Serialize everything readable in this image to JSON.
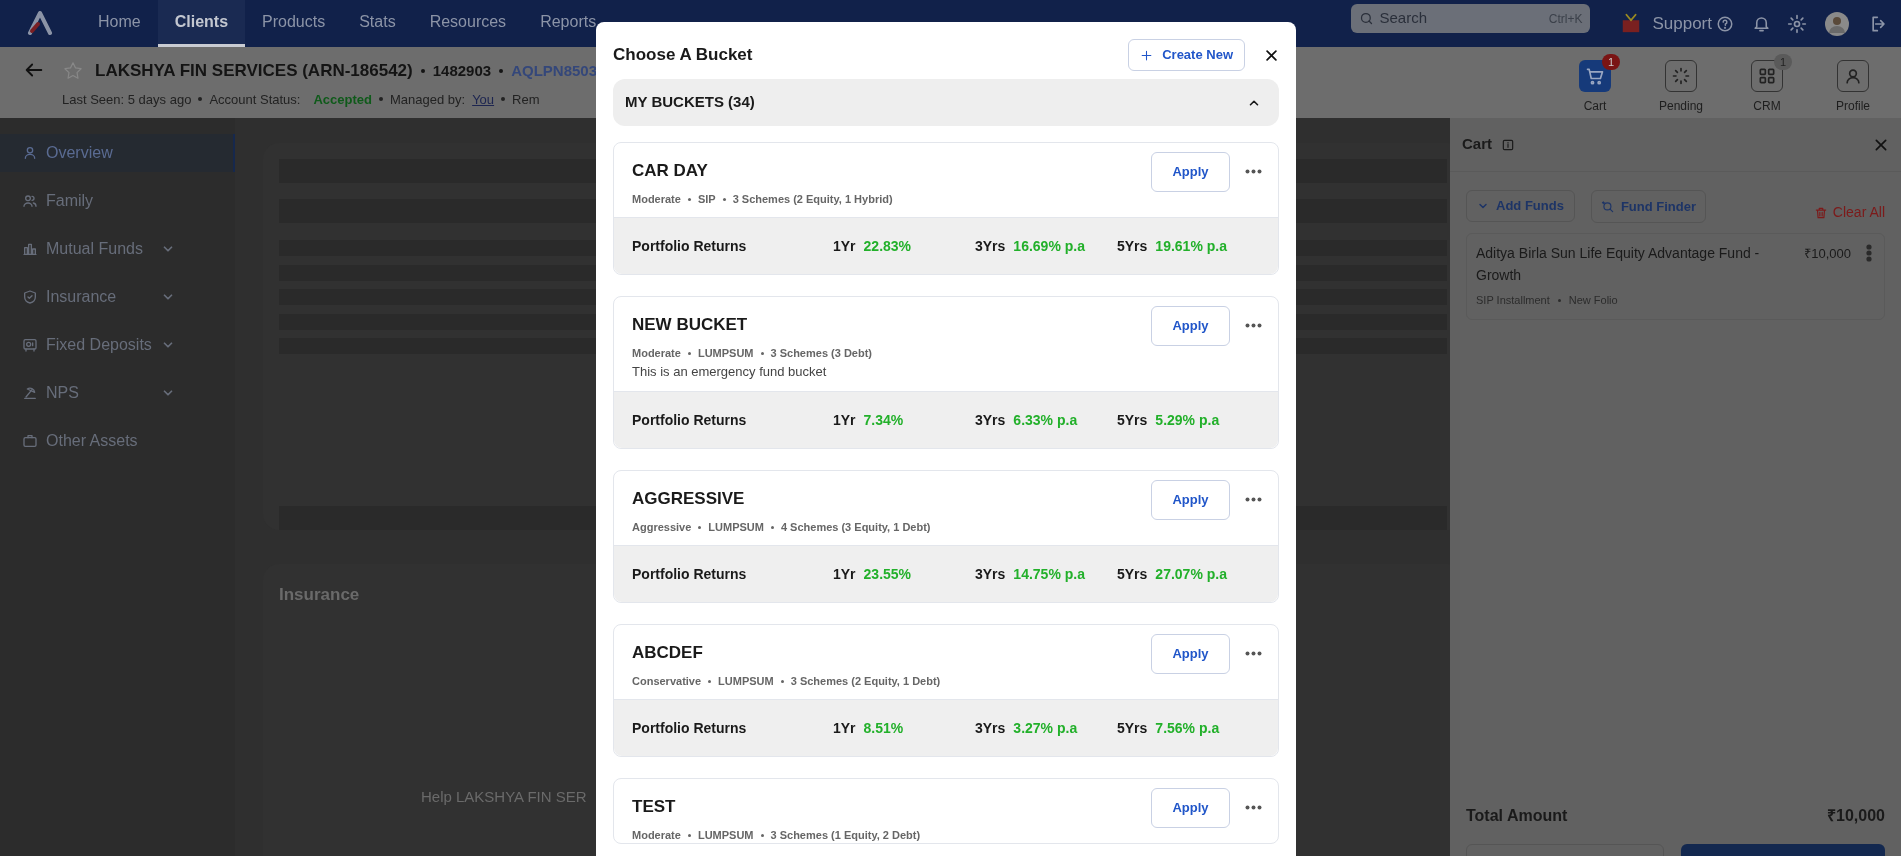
{
  "nav": {
    "items": [
      {
        "label": "Home",
        "selected": false
      },
      {
        "label": "Clients",
        "selected": true
      },
      {
        "label": "Products",
        "selected": false
      },
      {
        "label": "Stats",
        "selected": false
      },
      {
        "label": "Resources",
        "selected": false
      },
      {
        "label": "Reports",
        "selected": false
      }
    ],
    "search": {
      "placeholder": "Search",
      "shortcut": "Ctrl+K"
    },
    "support": "Support"
  },
  "client": {
    "name": "LAKSHYA FIN SERVICES (ARN-186542)",
    "code": "1482903",
    "pan": "AQLPN8503",
    "last_seen": "Last Seen: 5 days ago",
    "status_label": "Account Status:",
    "status": "Accepted",
    "managed_label": "Managed by:",
    "managed_by": "You",
    "more": "Rem"
  },
  "actions": [
    {
      "label": "Cart",
      "badge": "1",
      "selected": true
    },
    {
      "label": "Pending",
      "selected": false
    },
    {
      "label": "CRM",
      "badge": "1",
      "selected": false
    },
    {
      "label": "Profile",
      "selected": false
    }
  ],
  "sidebar": {
    "items": [
      {
        "label": "Overview",
        "selected": true,
        "expandable": false
      },
      {
        "label": "Family",
        "selected": false,
        "expandable": false
      },
      {
        "label": "Mutual Funds",
        "selected": false,
        "expandable": true
      },
      {
        "label": "Insurance",
        "selected": false,
        "expandable": true
      },
      {
        "label": "Fixed Deposits",
        "selected": false,
        "expandable": true
      },
      {
        "label": "NPS",
        "selected": false,
        "expandable": true
      },
      {
        "label": "Other Assets",
        "selected": false,
        "expandable": false
      }
    ]
  },
  "main": {
    "insurance_title": "Insurance",
    "help_text": "Help LAKSHYA FIN SER"
  },
  "cart": {
    "title": "Cart",
    "add_funds": "Add Funds",
    "fund_finder": "Fund Finder",
    "clear": "Clear All",
    "items": [
      {
        "name": "Aditya Birla Sun Life Equity Advantage Fund - Growth",
        "amount": "₹10,000",
        "mode": "SIP Installment",
        "folio": "New Folio"
      }
    ],
    "total_label": "Total Amount",
    "total": "₹10,000"
  },
  "modal": {
    "title": "Choose A Bucket",
    "create": "Create New",
    "section": {
      "title": "MY BUCKETS (34)",
      "expanded": true
    },
    "buckets": [
      {
        "name": "CAR DAY",
        "risk": "Moderate",
        "mode": "SIP",
        "schemes": "3 Schemes (2 Equity, 1 Hybrid)",
        "action": "Apply",
        "returns_label": "Portfolio Returns",
        "returns": [
          {
            "period": "1Yr",
            "value": "22.83%"
          },
          {
            "period": "3Yrs",
            "value": "16.69% p.a"
          },
          {
            "period": "5Yrs",
            "value": "19.61% p.a"
          }
        ]
      },
      {
        "name": "NEW BUCKET",
        "risk": "Moderate",
        "mode": "LUMPSUM",
        "schemes": "3 Schemes (3 Debt)",
        "description": "This is an emergency fund bucket",
        "action": "Apply",
        "returns_label": "Portfolio Returns",
        "returns": [
          {
            "period": "1Yr",
            "value": "7.34%"
          },
          {
            "period": "3Yrs",
            "value": "6.33% p.a"
          },
          {
            "period": "5Yrs",
            "value": "5.29% p.a"
          }
        ]
      },
      {
        "name": "AGGRESSIVE",
        "risk": "Aggressive",
        "mode": "LUMPSUM",
        "schemes": "4 Schemes (3 Equity, 1 Debt)",
        "action": "Apply",
        "returns_label": "Portfolio Returns",
        "returns": [
          {
            "period": "1Yr",
            "value": "23.55%"
          },
          {
            "period": "3Yrs",
            "value": "14.75% p.a"
          },
          {
            "period": "5Yrs",
            "value": "27.07% p.a"
          }
        ]
      },
      {
        "name": "ABCDEF",
        "risk": "Conservative",
        "mode": "LUMPSUM",
        "schemes": "3 Schemes (2 Equity, 1 Debt)",
        "action": "Apply",
        "returns_label": "Portfolio Returns",
        "returns": [
          {
            "period": "1Yr",
            "value": "8.51%"
          },
          {
            "period": "3Yrs",
            "value": "3.27% p.a"
          },
          {
            "period": "5Yrs",
            "value": "7.56% p.a"
          }
        ]
      },
      {
        "name": "TEST",
        "risk": "Moderate",
        "mode": "LUMPSUM",
        "schemes": "3 Schemes (1 Equity, 2 Debt)",
        "action": "Apply"
      }
    ]
  }
}
